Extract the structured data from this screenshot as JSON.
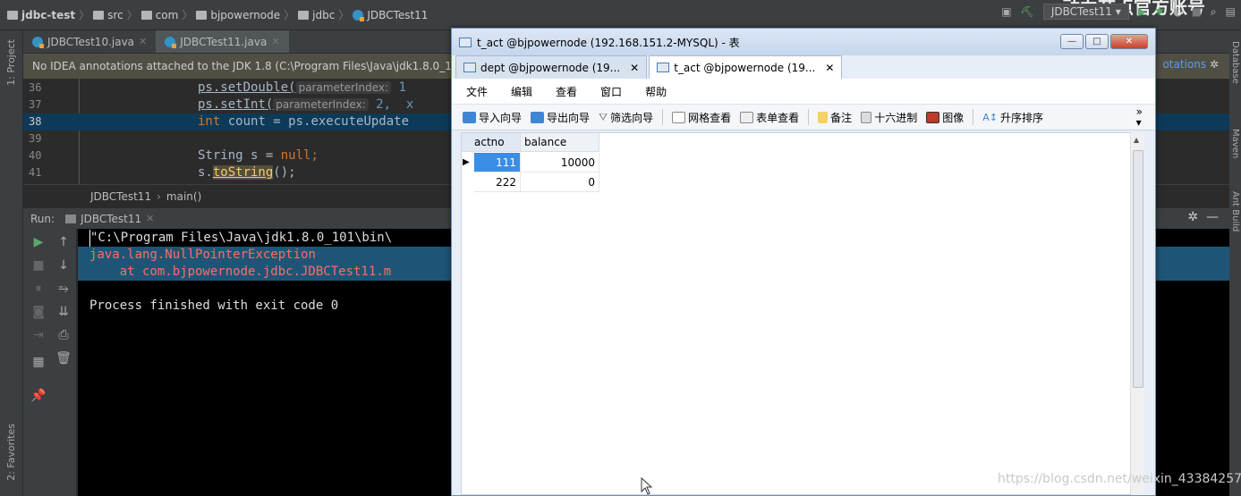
{
  "navbar": {
    "crumbs": [
      "jdbc-test",
      "src",
      "com",
      "bjpowernode",
      "jdbc",
      "JDBCTest11"
    ],
    "run_config": "JDBCTest11",
    "watermark": "动力节点官方账号"
  },
  "leftbar": {
    "project": "1: Project",
    "favorites": "2: Favorites"
  },
  "rightbar": {
    "database": "Database",
    "maven": "Maven",
    "ant": "Ant Build"
  },
  "editor": {
    "tabs": [
      {
        "label": "JDBCTest10.java"
      },
      {
        "label": "JDBCTest11.java"
      }
    ],
    "banner": "No IDEA annotations attached to the JDK 1.8 (C:\\Program Files\\Java\\jdk1.8.0_1",
    "banner_right": "otations",
    "lines": [
      {
        "num": "36",
        "code": "ps.setDouble(",
        "hint": "parameterIndex:",
        "rest": " 1"
      },
      {
        "num": "37",
        "code": "ps.setInt(",
        "hint": "parameterIndex:",
        "rest": " 2,  x"
      },
      {
        "num": "38",
        "kw": "int",
        "code": " count = ps.executeUpdate"
      },
      {
        "num": "39",
        "code": ""
      },
      {
        "num": "40",
        "code": "String s = ",
        "kw": "null",
        "rest": ";"
      },
      {
        "num": "41",
        "code": "s.",
        "call": "toString",
        "rest": "();"
      }
    ],
    "breadcrumb": [
      "JDBCTest11",
      "main()"
    ]
  },
  "run": {
    "label": "Run:",
    "tab": "JDBCTest11",
    "console": [
      "\"C:\\Program Files\\Java\\jdk1.8.0_101\\bin\\",
      "java.lang.NullPointerException",
      "    at com.bjpowernode.jdbc.JDBCTest11.m",
      "",
      "Process finished with exit code 0"
    ],
    "err_prefix": "java.lang.Null",
    "err_suffix": "PointerException"
  },
  "navicat": {
    "title": "t_act @bjpowernode (192.168.151.2-MYSQL) - 表",
    "tabs": [
      {
        "label": "dept @bjpowernode (19..."
      },
      {
        "label": "t_act @bjpowernode (19..."
      }
    ],
    "menu": [
      "文件",
      "编辑",
      "查看",
      "窗口",
      "帮助"
    ],
    "toolbar": [
      "导入向导",
      "导出向导",
      "筛选向导",
      "网格查看",
      "表单查看",
      "备注",
      "十六进制",
      "图像",
      "升序排序"
    ],
    "columns": [
      "actno",
      "balance"
    ],
    "rows": [
      [
        "111",
        "10000"
      ],
      [
        "222",
        "0"
      ]
    ]
  },
  "footer": {
    "csdn": "https://blog.csdn.net/weixin_43384257"
  }
}
